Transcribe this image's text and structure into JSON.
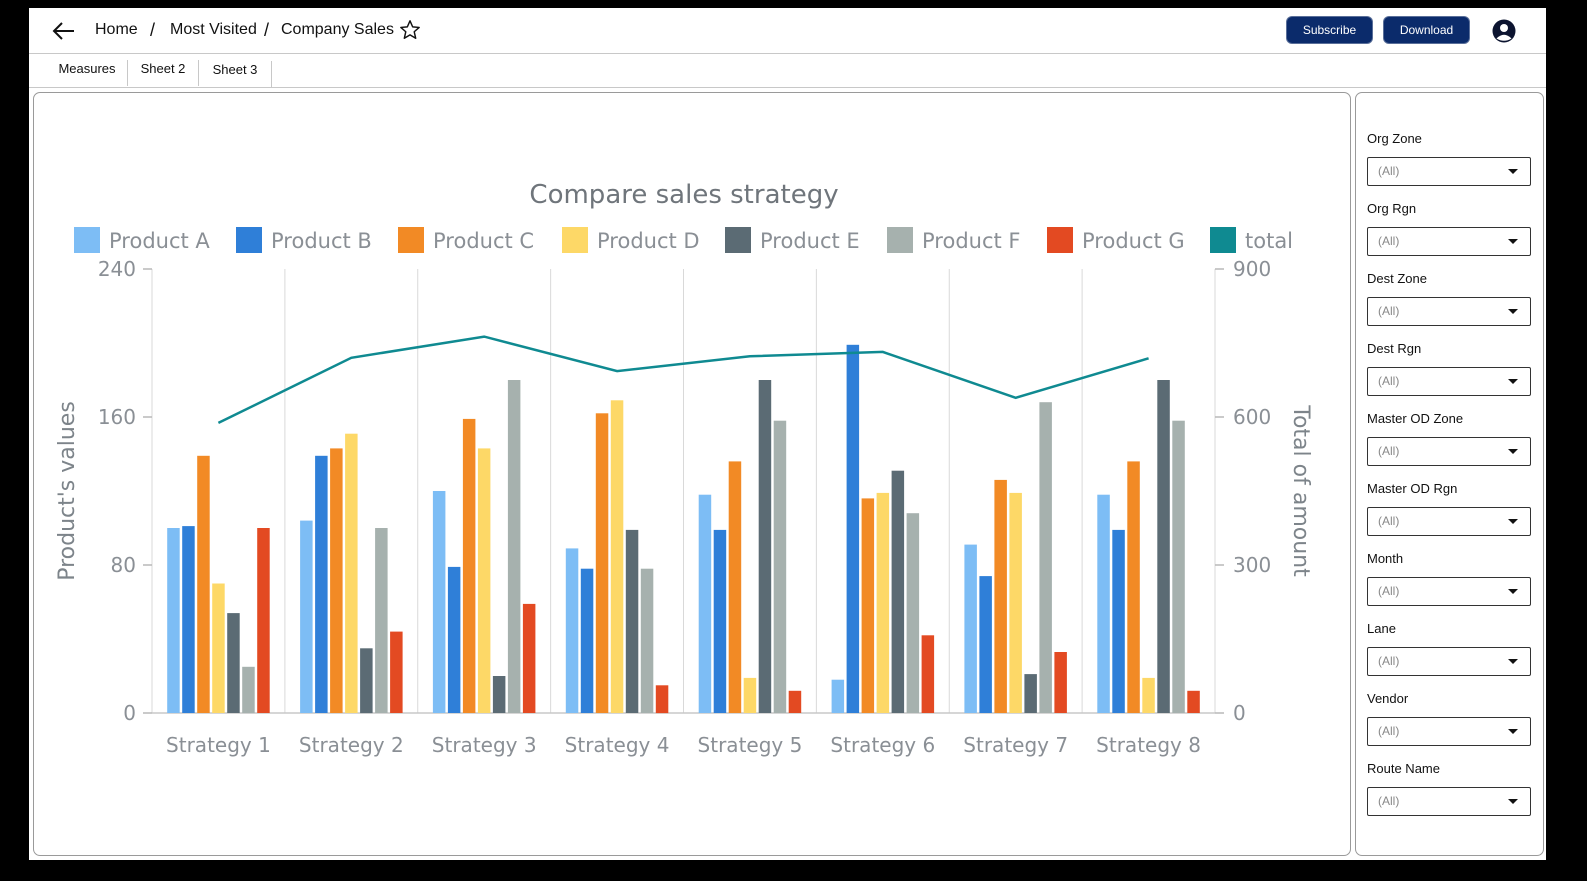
{
  "breadcrumb": {
    "home": "Home",
    "most_visited": "Most Visited",
    "current": "Company Sales"
  },
  "header": {
    "subscribe_label": "Subscribe",
    "download_label": "Download"
  },
  "tabs": [
    {
      "label": "Measures"
    },
    {
      "label": "Sheet 2"
    },
    {
      "label": "Sheet 3"
    }
  ],
  "filters": [
    {
      "label": "Org Zone",
      "value": "(All)"
    },
    {
      "label": "Org Rgn",
      "value": "(All)"
    },
    {
      "label": "Dest Zone",
      "value": "(All)"
    },
    {
      "label": "Dest Rgn",
      "value": "(All)"
    },
    {
      "label": "Master OD Zone",
      "value": "(All)"
    },
    {
      "label": "Master OD Rgn",
      "value": "(All)"
    },
    {
      "label": "Month",
      "value": "(All)"
    },
    {
      "label": "Lane",
      "value": "(All)"
    },
    {
      "label": "Vendor",
      "value": "(All)"
    },
    {
      "label": "Route Name",
      "value": "(All)"
    }
  ],
  "chart_data": {
    "type": "bar",
    "title": "Compare sales strategy",
    "ylabel": "Product's values",
    "y2label": "Total of amount",
    "ylim": [
      0,
      240
    ],
    "y2lim": [
      0,
      900
    ],
    "yticks": [
      "0",
      "80",
      "160",
      "240"
    ],
    "y2ticks": [
      "0",
      "300",
      "600",
      "900"
    ],
    "categories": [
      "Strategy 1",
      "Strategy 2",
      "Strategy 3",
      "Strategy 4",
      "Strategy 5",
      "Strategy 6",
      "Strategy 7",
      "Strategy 8"
    ],
    "series": [
      {
        "name": "Product A",
        "color": "#7dbdf5",
        "values": [
          100,
          104,
          120,
          89,
          118,
          18,
          91,
          118
        ]
      },
      {
        "name": "Product B",
        "color": "#2f7fd8",
        "values": [
          101,
          139,
          79,
          78,
          99,
          199,
          74,
          99
        ]
      },
      {
        "name": "Product C",
        "color": "#f28a25",
        "values": [
          139,
          143,
          159,
          162,
          136,
          116,
          126,
          136
        ]
      },
      {
        "name": "Product D",
        "color": "#fdd867",
        "values": [
          70,
          151,
          143,
          169,
          19,
          119,
          119,
          19
        ]
      },
      {
        "name": "Product E",
        "color": "#5b6b74",
        "values": [
          54,
          35,
          20,
          99,
          180,
          131,
          21,
          180
        ]
      },
      {
        "name": "Product F",
        "color": "#a6b1ae",
        "values": [
          25,
          100,
          180,
          78,
          158,
          108,
          168,
          158
        ]
      },
      {
        "name": "Product G",
        "color": "#e34a22",
        "values": [
          100,
          44,
          59,
          15,
          12,
          42,
          33,
          12
        ]
      }
    ],
    "total": {
      "name": "total",
      "color": "#0f8a91",
      "values": [
        588,
        720,
        763,
        693,
        723,
        732,
        639,
        719
      ]
    },
    "legend_position": "top"
  }
}
